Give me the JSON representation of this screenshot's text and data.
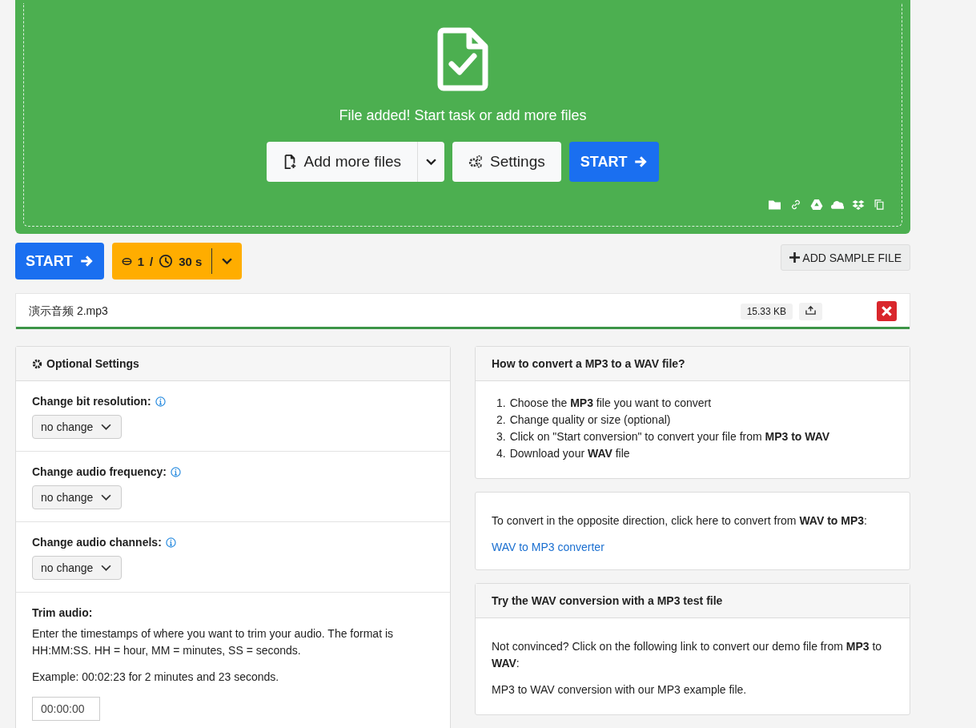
{
  "dropzone": {
    "message": "File added! Start task or add more files",
    "add_button": "Add more files",
    "settings_button": "Settings",
    "start_button": "START"
  },
  "toolbar": {
    "start_button": "START",
    "credits": "1",
    "separator": "/",
    "time": "30 s",
    "sample_button": "ADD SAMPLE FILE"
  },
  "file": {
    "name": "演示音频 2.mp3",
    "size": "15.33 KB",
    "level": 1
  },
  "optional_settings": {
    "title": "Optional Settings",
    "fields": [
      {
        "kind": "select",
        "label": "Change bit resolution:",
        "value": "no change"
      },
      {
        "kind": "select",
        "label": "Change audio frequency:",
        "value": "no change"
      },
      {
        "kind": "select",
        "label": "Change audio channels:",
        "value": "no change"
      },
      {
        "kind": "trim",
        "label": "Trim audio:",
        "paragraphs": [
          "Enter the timestamps of where you want to trim your audio. The format is HH:MM:SS. HH = hour, MM = minutes, SS = seconds.",
          "Example: 00:02:23 for 2 minutes and 23 seconds."
        ],
        "value": "00:00:00"
      }
    ]
  },
  "info_cards": [
    {
      "kind": "steps",
      "title": "How to convert a MP3 to a WAV file?",
      "steps": [
        {
          "number": "1.",
          "text": "Choose the **MP3** file you want to convert"
        },
        {
          "number": "2.",
          "text": "Change quality or size (optional)"
        },
        {
          "number": "3.",
          "text": "Click on \"Start conversion\" to convert your file from **MP3 to WAV**"
        },
        {
          "number": "4.",
          "text": "Download your **WAV** file"
        }
      ]
    },
    {
      "kind": "link",
      "text": "To convert in the opposite direction, click here to convert from **WAV to MP3**:",
      "link": "WAV to MP3 converter"
    },
    {
      "kind": "paragraphs",
      "title": "Try the WAV conversion with a MP3 test file",
      "paragraphs": [
        "Not convinced? Click on the following link to convert our demo file from **MP3** to **WAV**:",
        "MP3 to WAV conversion with our MP3 example file."
      ]
    }
  ]
}
